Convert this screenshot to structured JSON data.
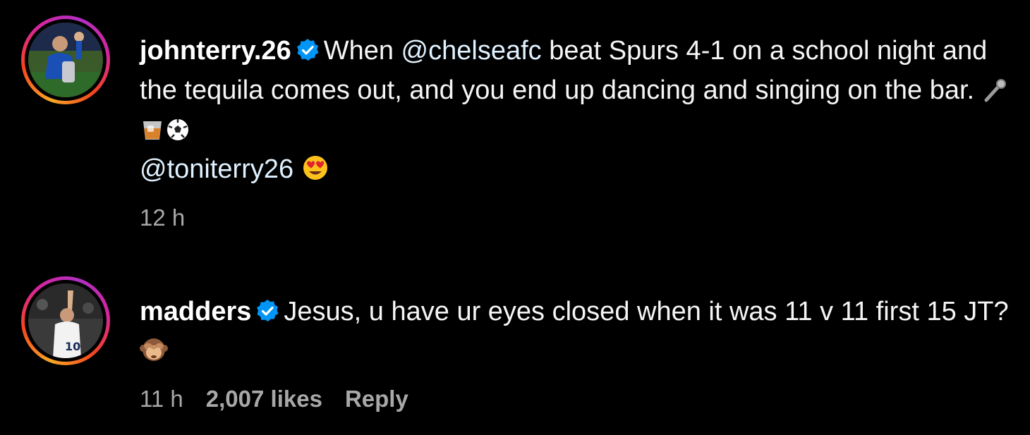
{
  "colors": {
    "background": "#000000",
    "text": "#f5f5f5",
    "secondary_text": "#a8a8a8",
    "verified_badge": "#0095f6"
  },
  "comments": [
    {
      "username": "johnterry.26",
      "verified": true,
      "text_parts": [
        "When ",
        "@chelseafc",
        " beat Spurs 4-1 on a school night and the tequila comes out, and you end up dancing and singing on the bar. ",
        "@toniterry26"
      ],
      "emojis": [
        "microphone-emoji",
        "tumbler-glass-emoji",
        "soccer-ball-emoji",
        "heart-eyes-emoji"
      ],
      "timestamp": "12 h"
    },
    {
      "username": "madders",
      "verified": true,
      "text": "Jesus, u have ur eyes closed when it was 11 v 11 first 15 JT?",
      "emojis": [
        "see-no-evil-monkey-emoji"
      ],
      "timestamp": "11 h",
      "likes": "2,007 likes",
      "reply_label": "Reply"
    }
  ]
}
